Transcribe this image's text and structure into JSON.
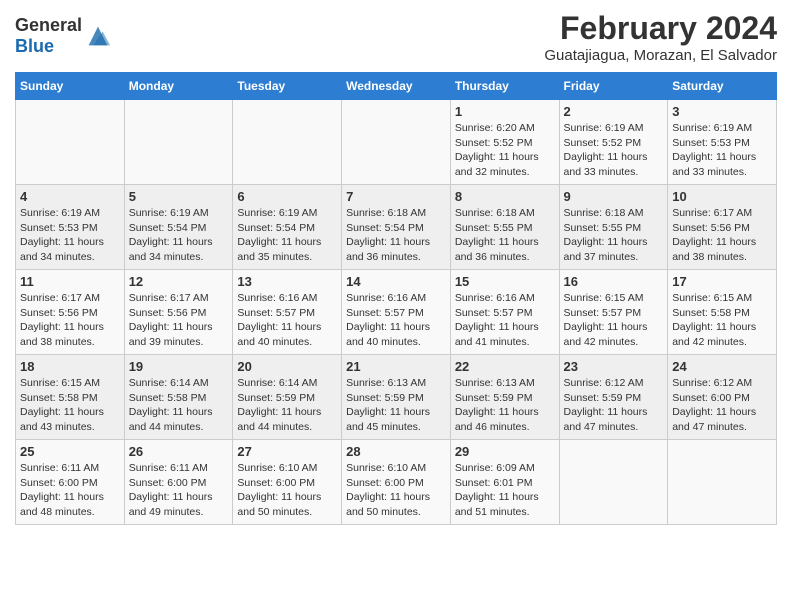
{
  "header": {
    "logo_general": "General",
    "logo_blue": "Blue",
    "title": "February 2024",
    "subtitle": "Guatajiagua, Morazan, El Salvador"
  },
  "days_of_week": [
    "Sunday",
    "Monday",
    "Tuesday",
    "Wednesday",
    "Thursday",
    "Friday",
    "Saturday"
  ],
  "weeks": [
    [
      {
        "day": "",
        "info": ""
      },
      {
        "day": "",
        "info": ""
      },
      {
        "day": "",
        "info": ""
      },
      {
        "day": "",
        "info": ""
      },
      {
        "day": "1",
        "info": "Sunrise: 6:20 AM\nSunset: 5:52 PM\nDaylight: 11 hours\nand 32 minutes."
      },
      {
        "day": "2",
        "info": "Sunrise: 6:19 AM\nSunset: 5:52 PM\nDaylight: 11 hours\nand 33 minutes."
      },
      {
        "day": "3",
        "info": "Sunrise: 6:19 AM\nSunset: 5:53 PM\nDaylight: 11 hours\nand 33 minutes."
      }
    ],
    [
      {
        "day": "4",
        "info": "Sunrise: 6:19 AM\nSunset: 5:53 PM\nDaylight: 11 hours\nand 34 minutes."
      },
      {
        "day": "5",
        "info": "Sunrise: 6:19 AM\nSunset: 5:54 PM\nDaylight: 11 hours\nand 34 minutes."
      },
      {
        "day": "6",
        "info": "Sunrise: 6:19 AM\nSunset: 5:54 PM\nDaylight: 11 hours\nand 35 minutes."
      },
      {
        "day": "7",
        "info": "Sunrise: 6:18 AM\nSunset: 5:54 PM\nDaylight: 11 hours\nand 36 minutes."
      },
      {
        "day": "8",
        "info": "Sunrise: 6:18 AM\nSunset: 5:55 PM\nDaylight: 11 hours\nand 36 minutes."
      },
      {
        "day": "9",
        "info": "Sunrise: 6:18 AM\nSunset: 5:55 PM\nDaylight: 11 hours\nand 37 minutes."
      },
      {
        "day": "10",
        "info": "Sunrise: 6:17 AM\nSunset: 5:56 PM\nDaylight: 11 hours\nand 38 minutes."
      }
    ],
    [
      {
        "day": "11",
        "info": "Sunrise: 6:17 AM\nSunset: 5:56 PM\nDaylight: 11 hours\nand 38 minutes."
      },
      {
        "day": "12",
        "info": "Sunrise: 6:17 AM\nSunset: 5:56 PM\nDaylight: 11 hours\nand 39 minutes."
      },
      {
        "day": "13",
        "info": "Sunrise: 6:16 AM\nSunset: 5:57 PM\nDaylight: 11 hours\nand 40 minutes."
      },
      {
        "day": "14",
        "info": "Sunrise: 6:16 AM\nSunset: 5:57 PM\nDaylight: 11 hours\nand 40 minutes."
      },
      {
        "day": "15",
        "info": "Sunrise: 6:16 AM\nSunset: 5:57 PM\nDaylight: 11 hours\nand 41 minutes."
      },
      {
        "day": "16",
        "info": "Sunrise: 6:15 AM\nSunset: 5:57 PM\nDaylight: 11 hours\nand 42 minutes."
      },
      {
        "day": "17",
        "info": "Sunrise: 6:15 AM\nSunset: 5:58 PM\nDaylight: 11 hours\nand 42 minutes."
      }
    ],
    [
      {
        "day": "18",
        "info": "Sunrise: 6:15 AM\nSunset: 5:58 PM\nDaylight: 11 hours\nand 43 minutes."
      },
      {
        "day": "19",
        "info": "Sunrise: 6:14 AM\nSunset: 5:58 PM\nDaylight: 11 hours\nand 44 minutes."
      },
      {
        "day": "20",
        "info": "Sunrise: 6:14 AM\nSunset: 5:59 PM\nDaylight: 11 hours\nand 44 minutes."
      },
      {
        "day": "21",
        "info": "Sunrise: 6:13 AM\nSunset: 5:59 PM\nDaylight: 11 hours\nand 45 minutes."
      },
      {
        "day": "22",
        "info": "Sunrise: 6:13 AM\nSunset: 5:59 PM\nDaylight: 11 hours\nand 46 minutes."
      },
      {
        "day": "23",
        "info": "Sunrise: 6:12 AM\nSunset: 5:59 PM\nDaylight: 11 hours\nand 47 minutes."
      },
      {
        "day": "24",
        "info": "Sunrise: 6:12 AM\nSunset: 6:00 PM\nDaylight: 11 hours\nand 47 minutes."
      }
    ],
    [
      {
        "day": "25",
        "info": "Sunrise: 6:11 AM\nSunset: 6:00 PM\nDaylight: 11 hours\nand 48 minutes."
      },
      {
        "day": "26",
        "info": "Sunrise: 6:11 AM\nSunset: 6:00 PM\nDaylight: 11 hours\nand 49 minutes."
      },
      {
        "day": "27",
        "info": "Sunrise: 6:10 AM\nSunset: 6:00 PM\nDaylight: 11 hours\nand 50 minutes."
      },
      {
        "day": "28",
        "info": "Sunrise: 6:10 AM\nSunset: 6:00 PM\nDaylight: 11 hours\nand 50 minutes."
      },
      {
        "day": "29",
        "info": "Sunrise: 6:09 AM\nSunset: 6:01 PM\nDaylight: 11 hours\nand 51 minutes."
      },
      {
        "day": "",
        "info": ""
      },
      {
        "day": "",
        "info": ""
      }
    ]
  ]
}
